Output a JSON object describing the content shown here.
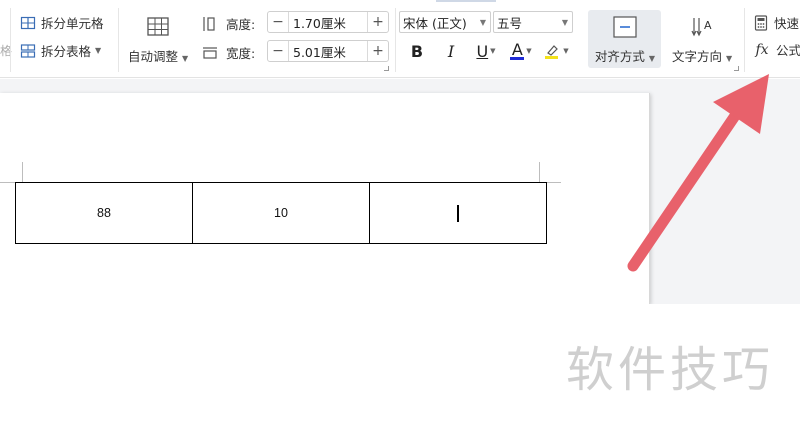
{
  "ribbon": {
    "split_cells": "拆分单元格",
    "split_table": "拆分表格",
    "auto_fit": "自动调整",
    "height_label": "高度:",
    "height_value": "1.70厘米",
    "width_label": "宽度:",
    "width_value": "5.01厘米",
    "font_name": "宋体 (正文)",
    "font_size": "五号",
    "bold": "B",
    "italic": "I",
    "underline": "U",
    "font_color_letter": "A",
    "align": "对齐方式",
    "text_direction": "文字方向",
    "quick_calc": "快速",
    "formula": "公式",
    "formula_symbol": "fx"
  },
  "table": {
    "rows": [
      [
        "88",
        "10",
        ""
      ]
    ]
  },
  "watermark": "软件技巧",
  "colors": {
    "arrow": "#e8616b",
    "font_color_underline": "#1f2bd6",
    "highlight": "#f3e21b"
  }
}
